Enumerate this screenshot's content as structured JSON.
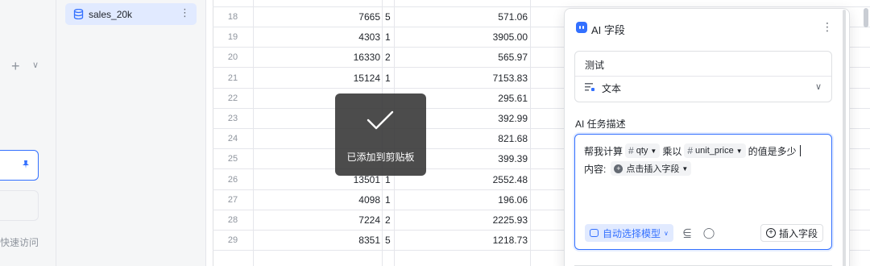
{
  "sidebar": {
    "quick_access": "快速访问"
  },
  "tables": {
    "active": "sales_20k"
  },
  "grid": {
    "rows": [
      {
        "n": "18",
        "a": "7665",
        "b": "5",
        "c": "571.06"
      },
      {
        "n": "19",
        "a": "4303",
        "b": "1",
        "c": "3905.00"
      },
      {
        "n": "20",
        "a": "16330",
        "b": "2",
        "c": "565.97"
      },
      {
        "n": "21",
        "a": "15124",
        "b": "1",
        "c": "7153.83"
      },
      {
        "n": "22",
        "a": "",
        "b": "",
        "c": "295.61"
      },
      {
        "n": "23",
        "a": "",
        "b": "",
        "c": "392.99"
      },
      {
        "n": "24",
        "a": "",
        "b": "",
        "c": "821.68"
      },
      {
        "n": "25",
        "a": "",
        "b": "",
        "c": "399.39"
      },
      {
        "n": "26",
        "a": "13501",
        "b": "1",
        "c": "2552.48"
      },
      {
        "n": "27",
        "a": "4098",
        "b": "1",
        "c": "196.06"
      },
      {
        "n": "28",
        "a": "7224",
        "b": "2",
        "c": "2225.93"
      },
      {
        "n": "29",
        "a": "8351",
        "b": "5",
        "c": "1218.73"
      }
    ]
  },
  "toast": {
    "message": "已添加到剪贴板"
  },
  "panel": {
    "title": "AI 字段",
    "field_name": "测试",
    "field_type": "文本",
    "desc_label": "AI 任务描述",
    "prompt": {
      "text1": "帮我计算",
      "chip1": "qty",
      "text2": "乘以",
      "chip2": "unit_price",
      "text3": "的值是多少",
      "content_label": "内容:",
      "insert_chip": "点击插入字段"
    },
    "model_label": "自动选择模型",
    "insert_label": "插入字段"
  },
  "colors": {
    "accent": "#3370ff",
    "toast_bg": "#333333"
  }
}
